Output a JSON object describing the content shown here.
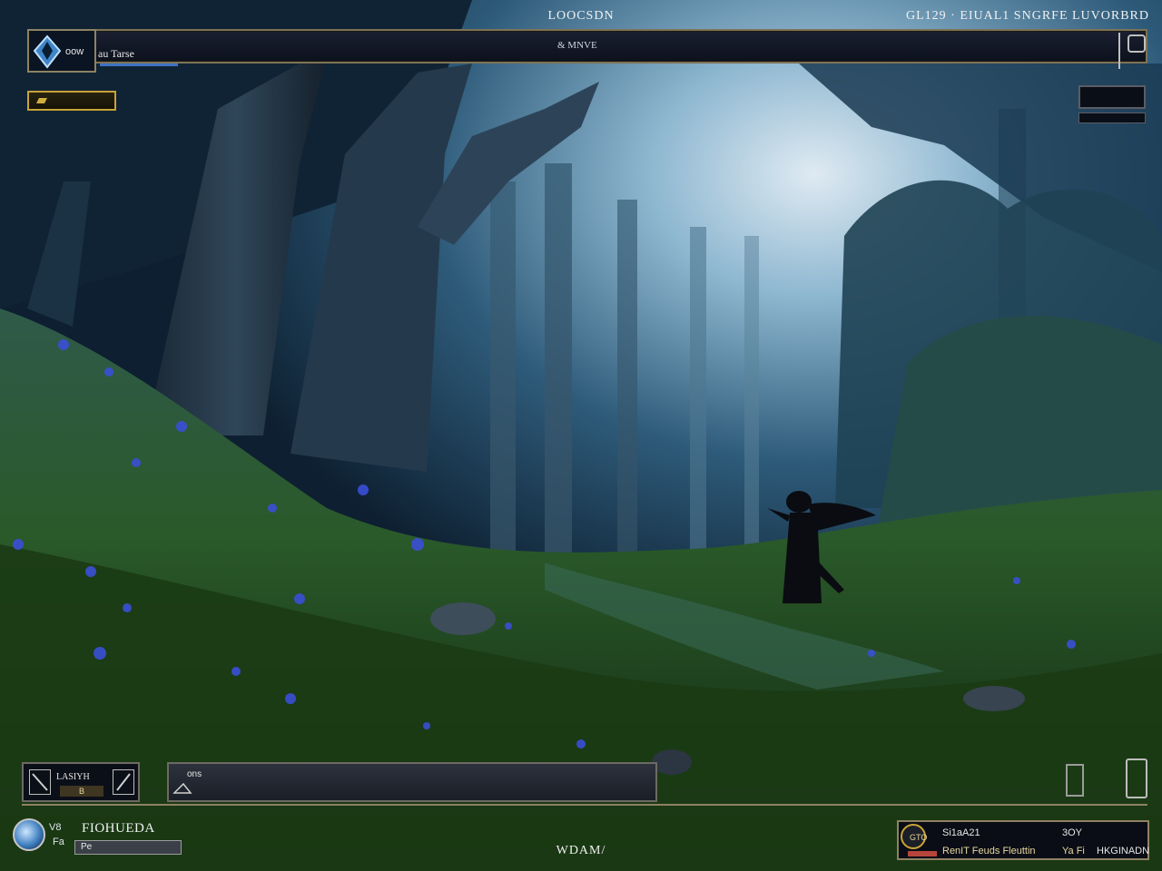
{
  "hud_top": {
    "title": "LOOCSDN",
    "status_right": "GL129 · EIUAL1  SNGRFE LUVORBRD",
    "portrait_label": "oow",
    "portrait_icon": "crystal-icon",
    "character_label": "au Tarse",
    "sub_label": "& MNVE",
    "gold_icon": "gold-bar-icon"
  },
  "hud_bottom": {
    "skill_label": "LASIYH",
    "skill_cost": "B",
    "chat_label": "ons",
    "chat_icon": "chat-icon",
    "center_text": "WDAM/",
    "player_tag_1": "V8",
    "player_tag_2": "Fa",
    "player_name": "FIOHUEDA",
    "player_bar_label": "Pe",
    "info_emblem": "GTO",
    "info_row1_left": "Si1aA21",
    "info_row1_right": "3OY",
    "info_row2_left": "RenIT Feuds Fleuttin",
    "info_row2_mid": "Ya Fi",
    "info_row2_right": "HKGINADN"
  },
  "colors": {
    "hud_border": "#8e8263",
    "gold_accent": "#c9a336",
    "xp_blue": "#3d73c4",
    "forest_glow": "#9fc3dc"
  }
}
